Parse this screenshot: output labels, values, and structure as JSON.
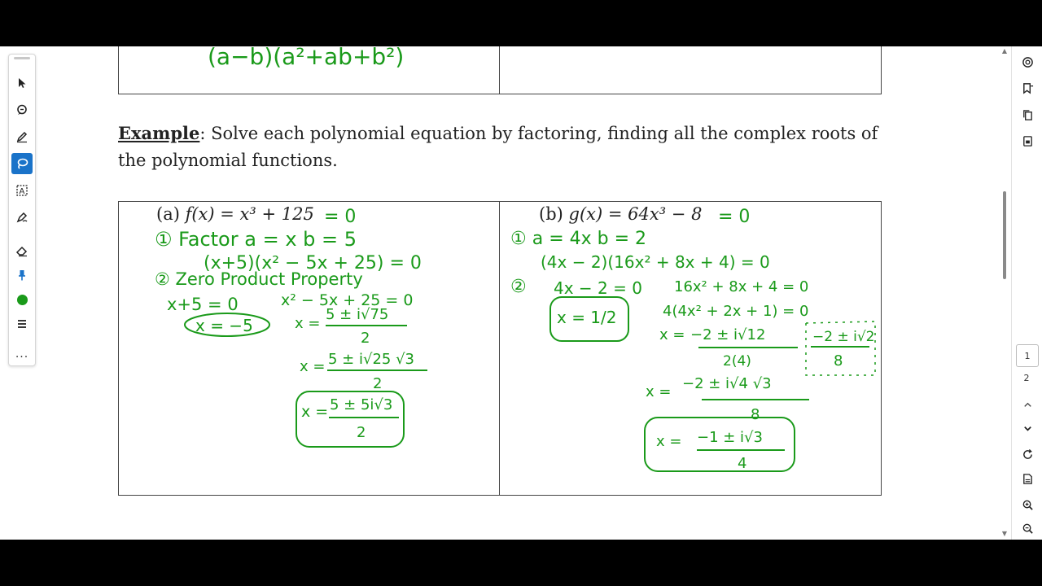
{
  "toolbar": {
    "tools": [
      {
        "name": "select-tool",
        "icon": "cursor-icon"
      },
      {
        "name": "comment-tool",
        "icon": "comment-icon"
      },
      {
        "name": "highlight-tool",
        "icon": "pen-icon"
      },
      {
        "name": "lasso-tool",
        "icon": "lasso-icon",
        "active": true
      },
      {
        "name": "text-select-tool",
        "icon": "text-box-icon"
      },
      {
        "name": "draw-tool",
        "icon": "draw-icon"
      },
      {
        "name": "eraser-tool",
        "icon": "eraser-icon"
      },
      {
        "name": "pin-tool",
        "icon": "pin-icon"
      },
      {
        "name": "color-tool",
        "icon": "color-dot-icon",
        "color": "#1a9a1a"
      },
      {
        "name": "menu-tool",
        "icon": "menu-icon"
      },
      {
        "name": "more-tool",
        "icon": "ellipsis-icon",
        "label": "..."
      }
    ]
  },
  "document": {
    "top_row_ink": "(a−b)(a²+ab+b²)",
    "example_label": "Example",
    "example_text": ": Solve each polynomial equation by factoring, finding all the complex roots of the polynomial functions.",
    "problem_a": {
      "prefix": "(a) ",
      "func": "f(x) = x³ + 125"
    },
    "problem_b": {
      "prefix": "(b) ",
      "func": "g(x) = 64x³ − 8"
    },
    "ink_color": "#1a9a1a",
    "work_a": {
      "eq0": "= 0",
      "step1": "① Factor  a = x   b = 5",
      "factored": "(x+5)(x² − 5x + 25) = 0",
      "step2": "② Zero Product Property",
      "lin": "x+5 = 0",
      "lin_sol": "x = −5",
      "quad": "x² − 5x + 25 = 0",
      "qf_x": "x =",
      "qf_num": "5 ± i√75",
      "qf_den": "2",
      "s2_x": "x =",
      "s2_num": "5 ± i√25 √3",
      "s2_den": "2",
      "final_x": "x =",
      "final_num": "5 ± 5i√3",
      "final_den": "2"
    },
    "work_b": {
      "eq0": "= 0",
      "step1": "①  a = 4x   b = 2",
      "factored": "(4x − 2)(16x² + 8x + 4) = 0",
      "step2": "②",
      "lin": "4x − 2 = 0",
      "lin_sol": "x = 1/2",
      "quad": "16x² + 8x + 4 = 0",
      "quad2": "4(4x² + 2x + 1) = 0",
      "qf_x": "x =",
      "qf_num": "−2 ± i√12",
      "qf_den": "2(4)",
      "side_num": "−2 ± i√2",
      "side_den": "8",
      "s2_x": "x =",
      "s2_num": "−2 ± i√4 √3",
      "s2_den": "8",
      "final_x": "x =",
      "final_num": "−1 ± i√3",
      "final_den": "4"
    }
  },
  "rightbar": {
    "icons": [
      "zoom-page-icon",
      "bookmark-icon",
      "copy-icon",
      "export-icon"
    ],
    "current_page": "1",
    "next_page": "2",
    "bottom_icons": [
      "chevron-up-icon",
      "chevron-down-icon",
      "refresh-icon",
      "save-icon",
      "zoom-in-icon",
      "zoom-out-icon"
    ]
  }
}
